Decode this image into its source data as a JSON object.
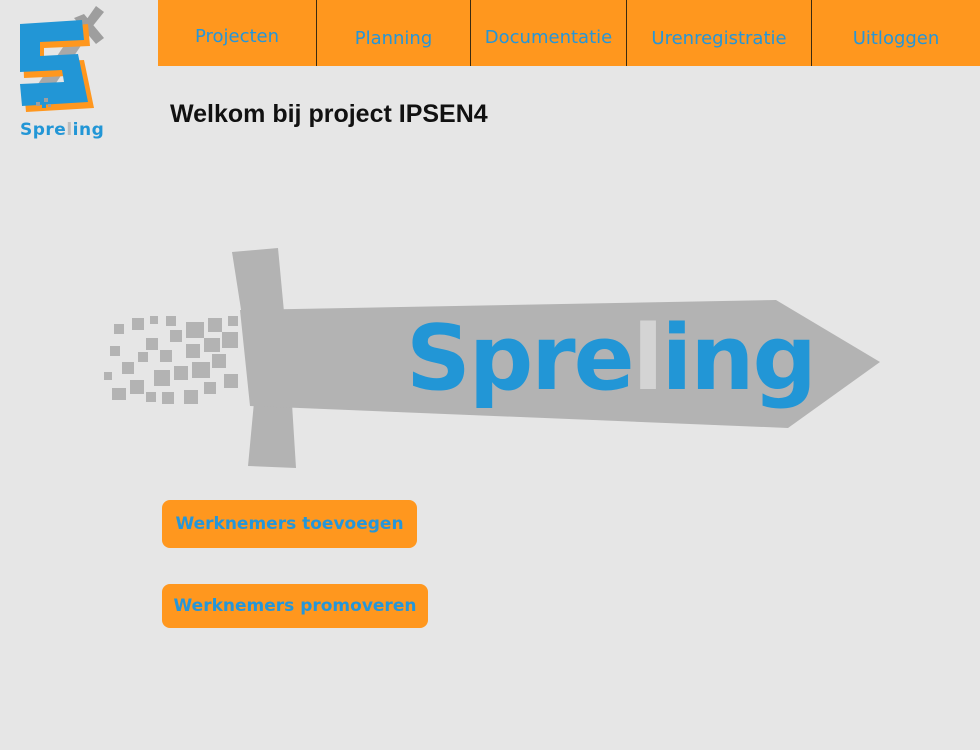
{
  "logo": {
    "text_pre": "Spre",
    "text_l": "l",
    "text_post": "ing"
  },
  "nav": {
    "items": [
      {
        "label": "Projecten"
      },
      {
        "label": "Planning"
      },
      {
        "label": "Documentatie"
      },
      {
        "label": "Urenregistratie"
      },
      {
        "label": "Uitloggen"
      }
    ]
  },
  "page": {
    "title": "Welkom bij project IPSEN4"
  },
  "banner": {
    "text_pre": "Spre",
    "text_l": "l",
    "text_post": "ing"
  },
  "actions": {
    "add_label": "Werknemers toevoegen",
    "promote_label": "Werknemers promoveren"
  },
  "colors": {
    "accent": "#ff971e",
    "link_blue": "#2596d9",
    "background": "#e6e6e6",
    "sword_grey": "#b3b3b3"
  }
}
